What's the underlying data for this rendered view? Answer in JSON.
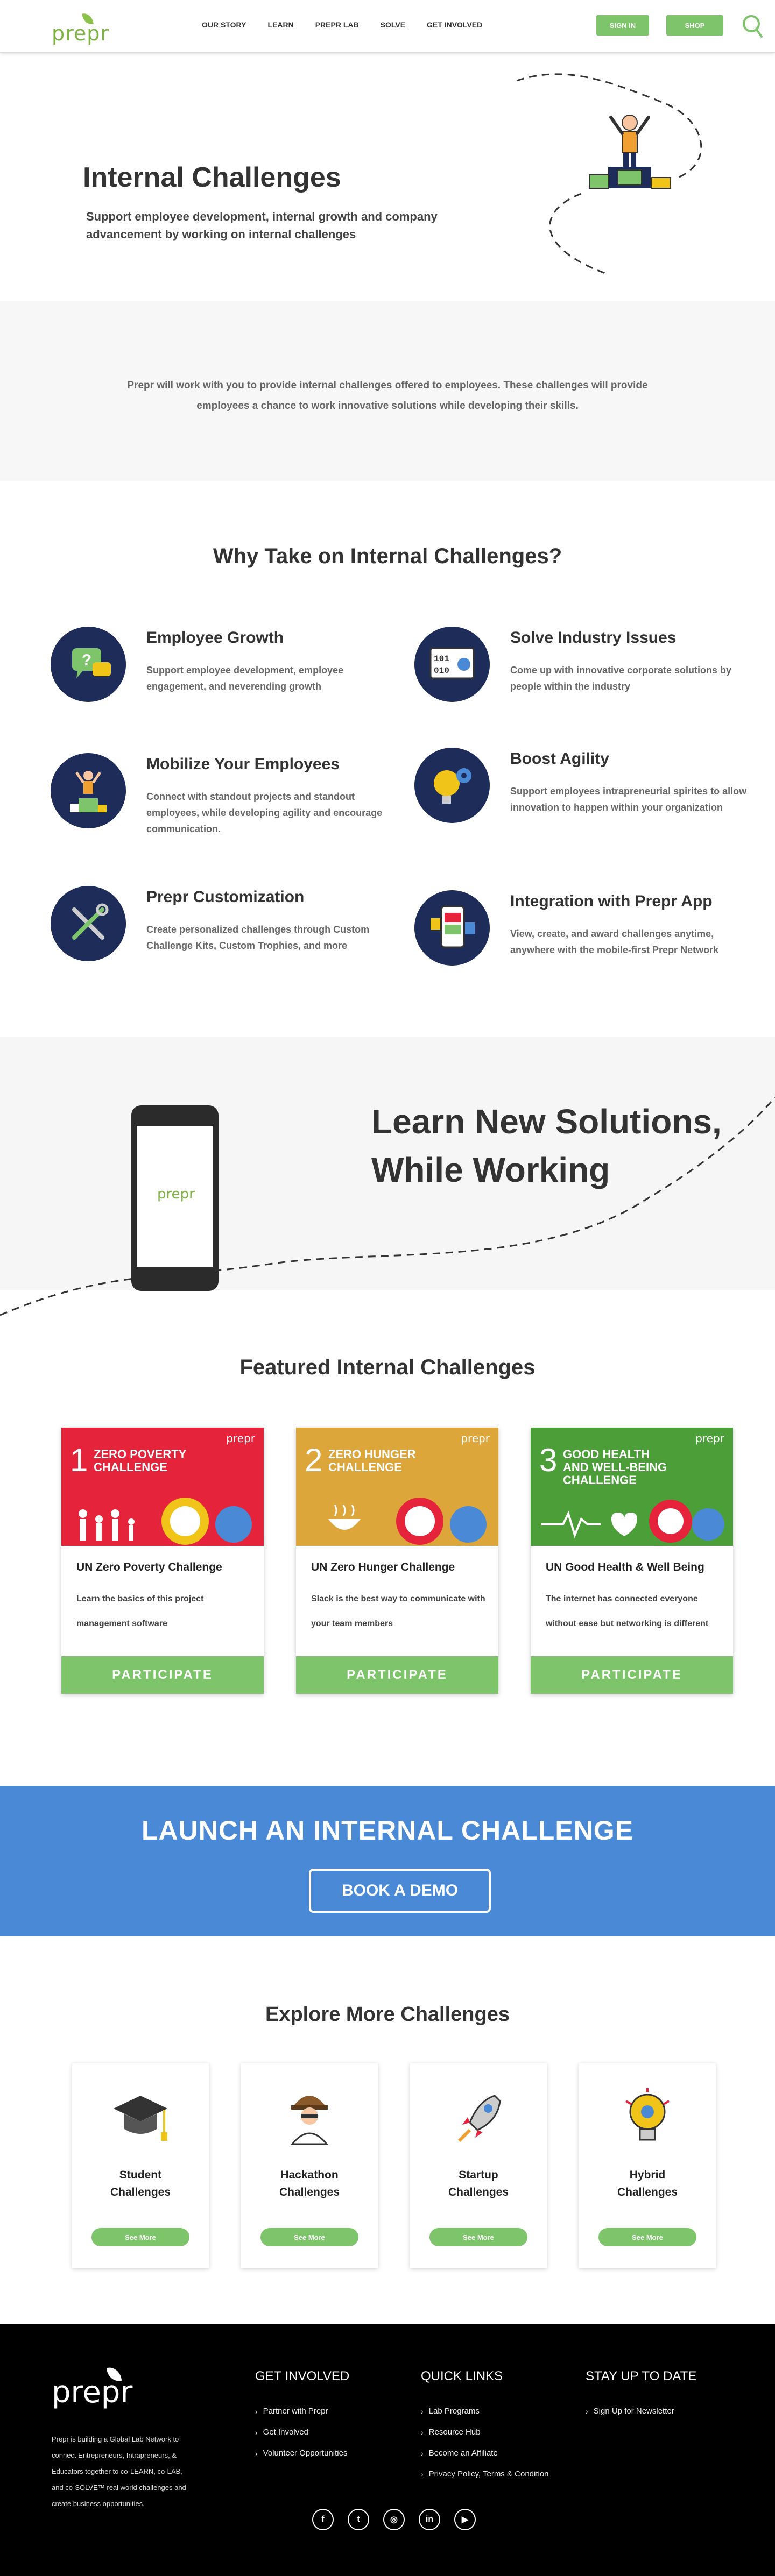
{
  "nav": {
    "logo": "prepr",
    "links": [
      "OUR STORY",
      "LEARN",
      "PREPR LAB",
      "SOLVE",
      "GET INVOLVED"
    ],
    "signin": "SIGN IN",
    "shop": "SHOP"
  },
  "hero": {
    "title": "Internal Challenges",
    "subtitle": "Support employee development, internal growth and company advancement by working on internal challenges"
  },
  "intro": {
    "text": "Prepr will work with you to provide internal challenges offered to employees. These challenges will provide employees a chance to work innovative solutions while developing their skills."
  },
  "why": {
    "title": "Why Take on Internal Challenges?",
    "features": [
      {
        "title": "Employee Growth",
        "desc": "Support employee development, employee engagement, and neverending growth"
      },
      {
        "title": "Solve Industry Issues",
        "desc": "Come up with innovative corporate solutions by people within the industry"
      },
      {
        "title": "Mobilize Your Employees",
        "desc": "Connect with standout projects and standout employees, while developing agility and encourage communication."
      },
      {
        "title": "Boost Agility",
        "desc": "Support employees intrapreneurial spirites to allow innovation to happen within your organization"
      },
      {
        "title": "Prepr Customization",
        "desc": "Create personalized challenges through Custom Challenge Kits, Custom Trophies, and more"
      },
      {
        "title": "Integration with Prepr App",
        "desc": "View, create, and award challenges anytime, anywhere with the mobile-first Prepr Network"
      }
    ]
  },
  "learn": {
    "title": "Learn New Solutions, While Working",
    "phone_logo": "prepr"
  },
  "featured": {
    "title": "Featured Internal Challenges",
    "cards": [
      {
        "num": "1",
        "goal": "ZERO POVERTY CHALLENGE",
        "brand": "prepr",
        "title": "UN Zero Poverty Challenge",
        "desc": "Learn the basics of this project management software",
        "button": "PARTICIPATE",
        "color": "#e5243b"
      },
      {
        "num": "2",
        "goal": "ZERO HUNGER CHALLENGE",
        "brand": "prepr",
        "title": "UN Zero Hunger Challenge",
        "desc": "Slack is the best way to communicate with your team members",
        "button": "PARTICIPATE",
        "color": "#dda63a"
      },
      {
        "num": "3",
        "goal": "GOOD HEALTH AND WELL-BEING CHALLENGE",
        "brand": "prepr",
        "title": "UN Good Health & Well Being",
        "desc": "The internet has connected everyone without ease but networking is different",
        "button": "PARTICIPATE",
        "color": "#4c9f38"
      }
    ]
  },
  "launch": {
    "title": "LAUNCH AN INTERNAL CHALLENGE",
    "button": "BOOK A DEMO"
  },
  "explore": {
    "title": "Explore More Challenges",
    "cards": [
      {
        "title1": "Student",
        "title2": "Challenges",
        "button": "See More"
      },
      {
        "title1": "Hackathon",
        "title2": "Challenges",
        "button": "See More"
      },
      {
        "title1": "Startup",
        "title2": "Challenges",
        "button": "See More"
      },
      {
        "title1": "Hybrid",
        "title2": "Challenges",
        "button": "See More"
      }
    ]
  },
  "footer": {
    "logo": "prepr",
    "blurb": "Prepr is building a Global Lab Network to connect Entrepreneurs, Intrapreneurs, & Educators together to co-LEARN, co-LAB, and co-SOLVE™ real world challenges and create business opportunities.",
    "get_involved": {
      "title": "GET INVOLVED",
      "links": [
        "Partner with Prepr",
        "Get Involved",
        "Volunteer Opportunities"
      ]
    },
    "quick_links": {
      "title": "QUICK LINKS",
      "links": [
        "Lab Programs",
        "Resource Hub",
        "Become an Affiliate",
        "Privacy Policy, Terms & Condition"
      ]
    },
    "stay": {
      "title": "STAY UP TO DATE",
      "links": [
        "Sign Up for Newsletter"
      ]
    },
    "social": [
      "f",
      "t",
      "◎",
      "in",
      "▶"
    ]
  },
  "colors": {
    "green": "#7dc46b",
    "blue": "#4a89d6",
    "navy": "#1e2c5a"
  }
}
